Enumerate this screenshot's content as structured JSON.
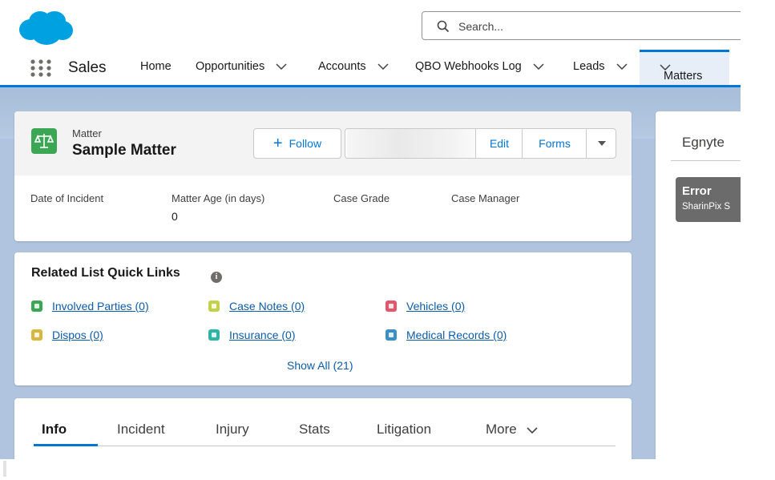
{
  "header": {
    "search_placeholder": "Search..."
  },
  "nav": {
    "app_name": "Sales",
    "items": [
      {
        "label": "Home",
        "has_menu": false
      },
      {
        "label": "Opportunities",
        "has_menu": true
      },
      {
        "label": "Accounts",
        "has_menu": true
      },
      {
        "label": "QBO Webhooks Log",
        "has_menu": true
      },
      {
        "label": "Leads",
        "has_menu": true
      }
    ],
    "active_tab": "Matters"
  },
  "record": {
    "object_type": "Matter",
    "title": "Sample Matter",
    "buttons": {
      "follow": "Follow",
      "edit": "Edit",
      "forms": "Forms"
    },
    "fields": [
      {
        "label": "Date of Incident",
        "value": ""
      },
      {
        "label": "Matter Age (in days)",
        "value": "0"
      },
      {
        "label": "Case Grade",
        "value": ""
      },
      {
        "label": "Case Manager",
        "value": ""
      }
    ]
  },
  "quick_links": {
    "title": "Related List Quick Links",
    "items": [
      {
        "label": "Involved Parties (0)",
        "color": "#3ba755"
      },
      {
        "label": "Case Notes (0)",
        "color": "#c1d24a"
      },
      {
        "label": "Vehicles (0)",
        "color": "#e3566b"
      },
      {
        "label": "Dispos (0)",
        "color": "#d8b83c"
      },
      {
        "label": "Insurance (0)",
        "color": "#2eb5a4"
      },
      {
        "label": "Medical Records (0)",
        "color": "#3a8fc4"
      }
    ],
    "show_all": "Show All (21)"
  },
  "tabs": {
    "items": [
      "Info",
      "Incident",
      "Injury",
      "Stats",
      "Litigation"
    ],
    "more": "More",
    "active": "Info"
  },
  "side_panel": {
    "title": "Egnyte",
    "error_title": "Error",
    "error_message": "SharinPix S"
  },
  "colors": {
    "brand": "#0176d3",
    "link": "#0b5cab",
    "matter_icon": "#3ba755",
    "error_bg": "#6b6b6b"
  }
}
